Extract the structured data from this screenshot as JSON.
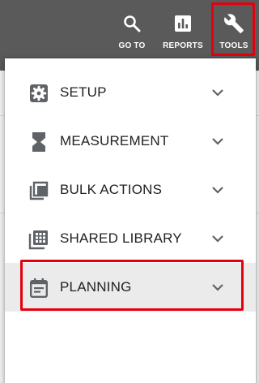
{
  "topbar": {
    "buttons": [
      {
        "label": "GO TO",
        "icon": "search-icon"
      },
      {
        "label": "REPORTS",
        "icon": "bar-chart-icon"
      },
      {
        "label": "TOOLS",
        "icon": "wrench-icon"
      }
    ],
    "highlighted": "TOOLS"
  },
  "menu": {
    "items": [
      {
        "label": "SETUP",
        "icon": "gear-icon"
      },
      {
        "label": "MEASUREMENT",
        "icon": "hourglass-icon"
      },
      {
        "label": "BULK ACTIONS",
        "icon": "stacked-copies-icon"
      },
      {
        "label": "SHARED LIBRARY",
        "icon": "grid-library-icon"
      },
      {
        "label": "PLANNING",
        "icon": "calendar-notes-icon"
      }
    ],
    "active_item": "PLANNING"
  },
  "colors": {
    "topbar_bg": "#5a5a5a",
    "highlight_border": "#e3000f",
    "active_row_bg": "#ebebeb",
    "icon_gray": "#5f6368"
  }
}
